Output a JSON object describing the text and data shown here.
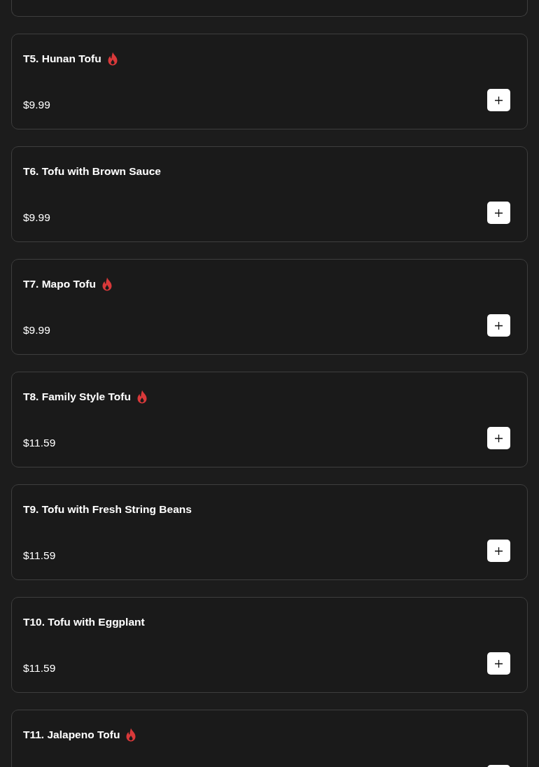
{
  "items": [
    {
      "name": "T5. Hunan Tofu",
      "spicy": true,
      "price": "$9.99"
    },
    {
      "name": "T6. Tofu with Brown Sauce",
      "spicy": false,
      "price": "$9.99"
    },
    {
      "name": "T7. Mapo Tofu",
      "spicy": true,
      "price": "$9.99"
    },
    {
      "name": "T8. Family Style Tofu",
      "spicy": true,
      "price": "$11.59"
    },
    {
      "name": "T9. Tofu with Fresh String Beans",
      "spicy": false,
      "price": "$11.59"
    },
    {
      "name": "T10. Tofu with Eggplant",
      "spicy": false,
      "price": "$11.59"
    },
    {
      "name": "T11. Jalapeno Tofu",
      "spicy": true
    }
  ]
}
